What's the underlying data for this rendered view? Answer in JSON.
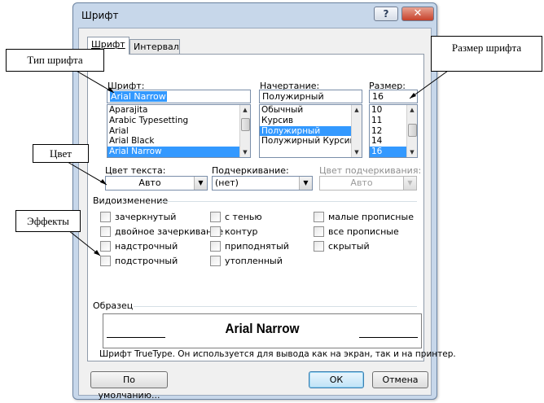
{
  "window": {
    "title": "Шрифт",
    "help_label": "?",
    "close_label": "✕"
  },
  "tabs": [
    {
      "label": "Шрифт",
      "active": true
    },
    {
      "label": "Интервал",
      "active": false
    }
  ],
  "font": {
    "label": "Шрифт:",
    "value": "Arial Narrow",
    "items": [
      "Aparajita",
      "Arabic Typesetting",
      "Arial",
      "Arial Black",
      "Arial Narrow"
    ],
    "selected": "Arial Narrow"
  },
  "style": {
    "label": "Начертание:",
    "value": "Полужирный",
    "items": [
      "Обычный",
      "Курсив",
      "Полужирный",
      "Полужирный Курсив"
    ],
    "selected": "Полужирный"
  },
  "size": {
    "label": "Размер:",
    "value": "16",
    "items": [
      "10",
      "11",
      "12",
      "14",
      "16"
    ],
    "selected": "16"
  },
  "text_color": {
    "label": "Цвет текста:",
    "value": "Авто"
  },
  "underline": {
    "label": "Подчеркивание:",
    "value": "(нет)"
  },
  "underline_color": {
    "label": "Цвет подчеркивания:",
    "value": "Авто"
  },
  "effects": {
    "group_label": "Видоизменение",
    "col1": [
      "зачеркнутый",
      "двойное зачеркивание",
      "надстрочный",
      "подстрочный"
    ],
    "col2": [
      "с тенью",
      "контур",
      "приподнятый",
      "утопленный"
    ],
    "col3": [
      "малые прописные",
      "все прописные",
      "скрытый"
    ]
  },
  "sample": {
    "group_label": "Образец",
    "text": "Arial Narrow",
    "note": "Шрифт TrueType. Он используется для вывода как на экран, так и на принтер."
  },
  "buttons": {
    "default_label": "По умолчанию...",
    "ok_label": "ОК",
    "cancel_label": "Отмена"
  },
  "callouts": {
    "font_type": "Тип шрифта",
    "font_size": "Размер шрифта",
    "color": "Цвет",
    "effects": "Эффекты"
  },
  "colors": {
    "selection": "#3399ff",
    "window_frame": "#c7d7ea",
    "close_button": "#c6412a"
  }
}
